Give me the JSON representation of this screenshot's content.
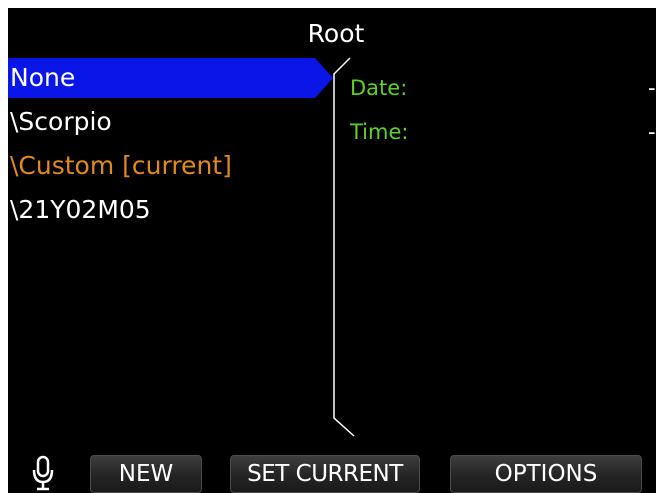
{
  "header": {
    "title": "Root"
  },
  "folders": [
    {
      "label": "None",
      "selected": true,
      "current": false
    },
    {
      "label": "\\Scorpio",
      "selected": false,
      "current": false
    },
    {
      "label": "\\Custom [current]",
      "selected": false,
      "current": true
    },
    {
      "label": "\\21Y02M05",
      "selected": false,
      "current": false
    }
  ],
  "details": {
    "date_label": "Date:",
    "date_value": "-",
    "time_label": "Time:",
    "time_value": "-"
  },
  "softkeys": {
    "new_label": "NEW",
    "set_current_label": "SET CURRENT",
    "options_label": "OPTIONS"
  },
  "status": {
    "mic_icon": "microphone-icon"
  },
  "colors": {
    "background": "#000000",
    "selection": "#0a16e8",
    "current_item": "#e08a1e",
    "detail_label": "#5fd02a",
    "text": "#ffffff"
  }
}
